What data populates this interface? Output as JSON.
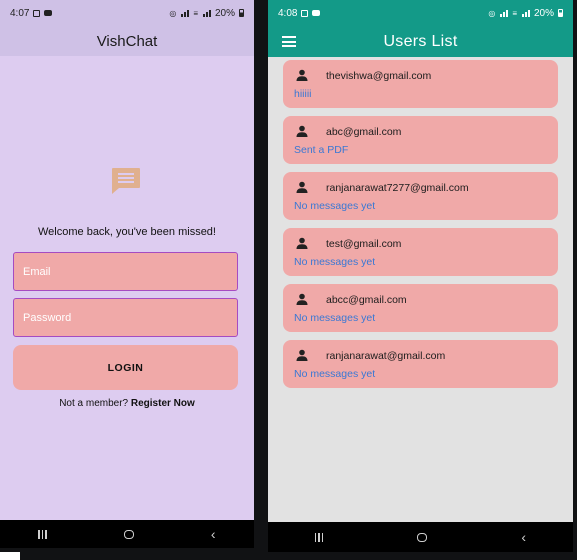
{
  "login_screen": {
    "status_bar": {
      "time": "4:07",
      "battery": "20%"
    },
    "app_title": "VishChat",
    "welcome_text": "Welcome back, you've been missed!",
    "email_placeholder": "Email",
    "password_placeholder": "Password",
    "login_label": "LOGIN",
    "not_member_text": "Not a member?",
    "register_label": "Register Now",
    "logo_icon": "chat-message-icon",
    "colors": {
      "background": "#ddccf0",
      "app_bar": "#cfc1e6",
      "field": "#f0a9a8",
      "field_border": "#a54bc2",
      "logo": "#e0b08f"
    }
  },
  "users_screen": {
    "status_bar": {
      "time": "4:08",
      "battery": "20%"
    },
    "app_title": "Users List",
    "menu_icon": "hamburger-menu-icon",
    "users": [
      {
        "email": "thevishwa@gmail.com",
        "last_message": "hiiiii"
      },
      {
        "email": "abc@gmail.com",
        "last_message": "Sent a PDF"
      },
      {
        "email": "ranjanarawat7277@gmail.com",
        "last_message": "No messages yet"
      },
      {
        "email": "test@gmail.com",
        "last_message": "No messages yet"
      },
      {
        "email": "abcc@gmail.com",
        "last_message": "No messages yet"
      },
      {
        "email": "ranjanarawat@gmail.com",
        "last_message": "No messages yet"
      }
    ],
    "colors": {
      "app_bar": "#139a88",
      "card": "#f0a9a8",
      "message_text": "#3a78d4",
      "background": "#e2e2e2"
    }
  },
  "nav_bar": {
    "icons": [
      "recent-apps-icon",
      "home-icon",
      "back-icon"
    ]
  }
}
